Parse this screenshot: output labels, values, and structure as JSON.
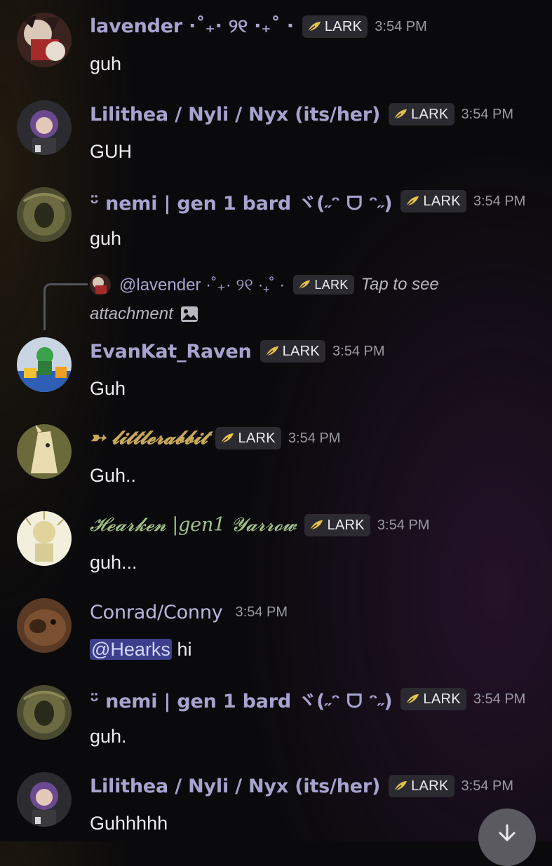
{
  "messages": [
    {
      "username": "lavender ·˚₊· ୨୧ ·₊˚ ·",
      "badge": "LARK",
      "time": "3:54 PM",
      "text": "guh"
    },
    {
      "username": "Lilithea / Nyli / Nyx (its/her)",
      "badge": "LARK",
      "time": "3:54 PM",
      "text": "GUH"
    },
    {
      "username": "ᵕ̈ nemi | gen 1 bard ヾ(˶ᵔ ᗜ ᵔ˶)",
      "badge": "LARK",
      "time": "3:54 PM",
      "text": "guh"
    },
    {
      "username": "EvanKat_Raven",
      "badge": "LARK",
      "time": "3:54 PM",
      "text": "Guh"
    },
    {
      "username": "➳ 𝓵𝓲𝓽𝓽𝓵𝓮𝓻𝓪𝓫𝓫𝓲𝓽",
      "badge": "LARK",
      "time": "3:54 PM",
      "text": "Guh.."
    },
    {
      "username": "𝓗𝓮𝓪𝓻𝓴𝓮𝓷 |gen1 𝓨𝓪𝓻𝓻𝓸𝔀",
      "badge": "LARK",
      "time": "3:54 PM",
      "text": "guh..."
    },
    {
      "username": "Conrad/Conny",
      "time": "3:54 PM",
      "mention": "@Hearks",
      "text": " hi"
    },
    {
      "username": "ᵕ̈ nemi | gen 1 bard ヾ(˶ᵔ ᗜ ᵔ˶)",
      "badge": "LARK",
      "time": "3:54 PM",
      "text": "guh."
    },
    {
      "username": "Lilithea / Nyli / Nyx (its/her)",
      "badge": "LARK",
      "time": "3:54 PM",
      "text": "Guhhhhh"
    }
  ],
  "reply": {
    "username": "@lavender ·˚₊· ୨୧ ·₊˚ ·",
    "badge": "LARK",
    "text_part1": "Tap to see",
    "text_part2": "attachment"
  },
  "icons": {
    "badge": "feather-icon",
    "attachment": "image-icon",
    "scroll": "arrow-down-icon"
  },
  "colors": {
    "username": "#a7a3cf",
    "mention_bg": "#3d3f8c",
    "badge_bg": "#2a2a30",
    "timestamp": "#9a9aa3"
  }
}
